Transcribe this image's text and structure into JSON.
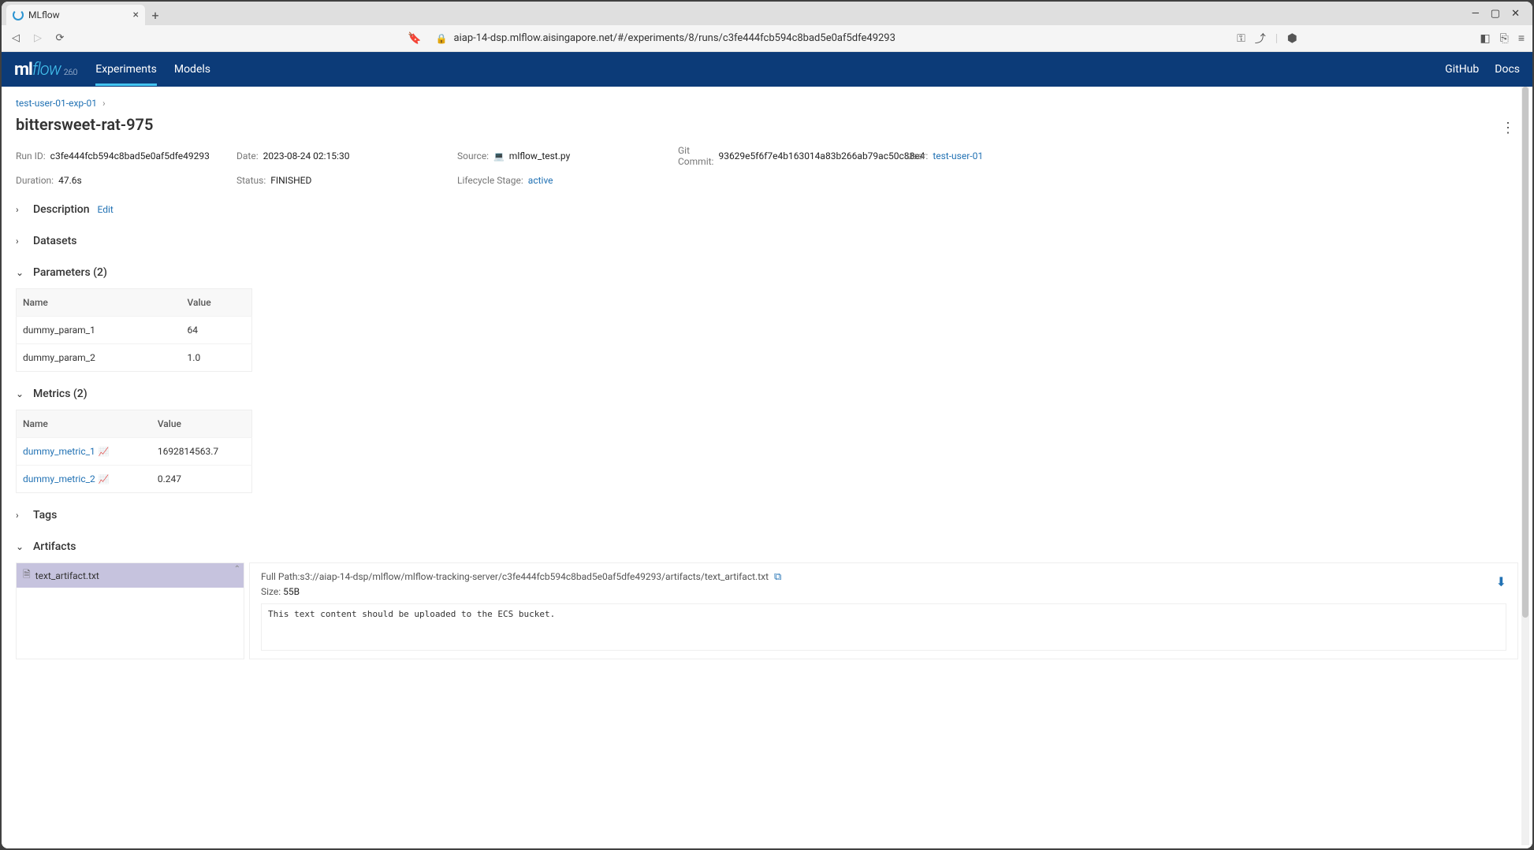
{
  "browser": {
    "tab_title": "MLflow",
    "url": "aiap-14-dsp.mlflow.aisingapore.net/#/experiments/8/runs/c3fe444fcb594c8bad5e0af5dfe49293"
  },
  "topnav": {
    "version": "2.6.0",
    "links": {
      "experiments": "Experiments",
      "models": "Models"
    },
    "right": {
      "github": "GitHub",
      "docs": "Docs"
    }
  },
  "breadcrumb": {
    "experiment": "test-user-01-exp-01"
  },
  "run": {
    "title": "bittersweet-rat-975",
    "run_id_label": "Run ID:",
    "run_id": "c3fe444fcb594c8bad5e0af5dfe49293",
    "date_label": "Date:",
    "date": "2023-08-24 02:15:30",
    "source_label": "Source:",
    "source": "mlflow_test.py",
    "git_label": "Git Commit:",
    "git": "93629e5f6f7e4b163014a83b266ab79ac50c88e4",
    "user_label": "User:",
    "user": "test-user-01",
    "duration_label": "Duration:",
    "duration": "47.6s",
    "status_label": "Status:",
    "status": "FINISHED",
    "lifecycle_label": "Lifecycle Stage:",
    "lifecycle": "active"
  },
  "sections": {
    "description": "Description",
    "description_edit": "Edit",
    "datasets": "Datasets",
    "parameters": "Parameters (2)",
    "metrics": "Metrics (2)",
    "tags": "Tags",
    "artifacts": "Artifacts"
  },
  "table_headers": {
    "name": "Name",
    "value": "Value"
  },
  "parameters": [
    {
      "name": "dummy_param_1",
      "value": "64"
    },
    {
      "name": "dummy_param_2",
      "value": "1.0"
    }
  ],
  "metrics": [
    {
      "name": "dummy_metric_1",
      "value": "1692814563.7"
    },
    {
      "name": "dummy_metric_2",
      "value": "0.247"
    }
  ],
  "artifacts": {
    "selected": "text_artifact.txt",
    "full_path_label": "Full Path:",
    "full_path": "s3://aiap-14-dsp/mlflow/mlflow-tracking-server/c3fe444fcb594c8bad5e0af5dfe49293/artifacts/text_artifact.txt",
    "size_label": "Size:",
    "size": "55B",
    "content": "This text content should be uploaded to the ECS bucket."
  }
}
